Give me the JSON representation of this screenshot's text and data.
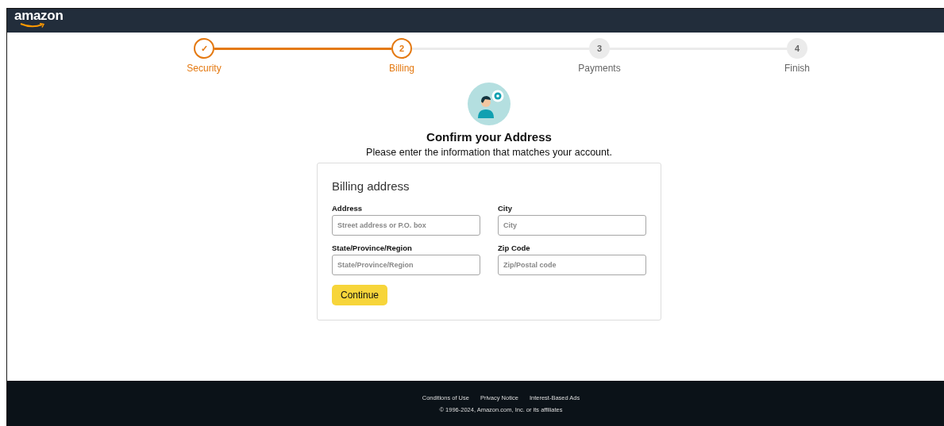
{
  "header": {
    "logo": "amazon"
  },
  "steps": [
    {
      "marker": "✓",
      "label": "Security",
      "reached": true
    },
    {
      "marker": "2",
      "label": "Billing",
      "reached": true
    },
    {
      "marker": "3",
      "label": "Payments",
      "reached": false
    },
    {
      "marker": "4",
      "label": "Finish",
      "reached": false
    }
  ],
  "heading": {
    "title": "Confirm your Address",
    "subtitle": "Please enter the information that matches your account."
  },
  "form": {
    "title": "Billing address",
    "fields": [
      {
        "label": "Address",
        "placeholder": "Street address or P.O. box"
      },
      {
        "label": "City",
        "placeholder": "City"
      },
      {
        "label": "State/Province/Region",
        "placeholder": "State/Province/Region"
      },
      {
        "label": "Zip Code",
        "placeholder": "Zip/Postal code"
      }
    ],
    "button": "Continue"
  },
  "footer": {
    "links": [
      "Conditions of Use",
      "Privacy Notice",
      "Interest-Based Ads"
    ],
    "copyright": "© 1996-2024, Amazon.com, Inc. or its affiliates"
  }
}
